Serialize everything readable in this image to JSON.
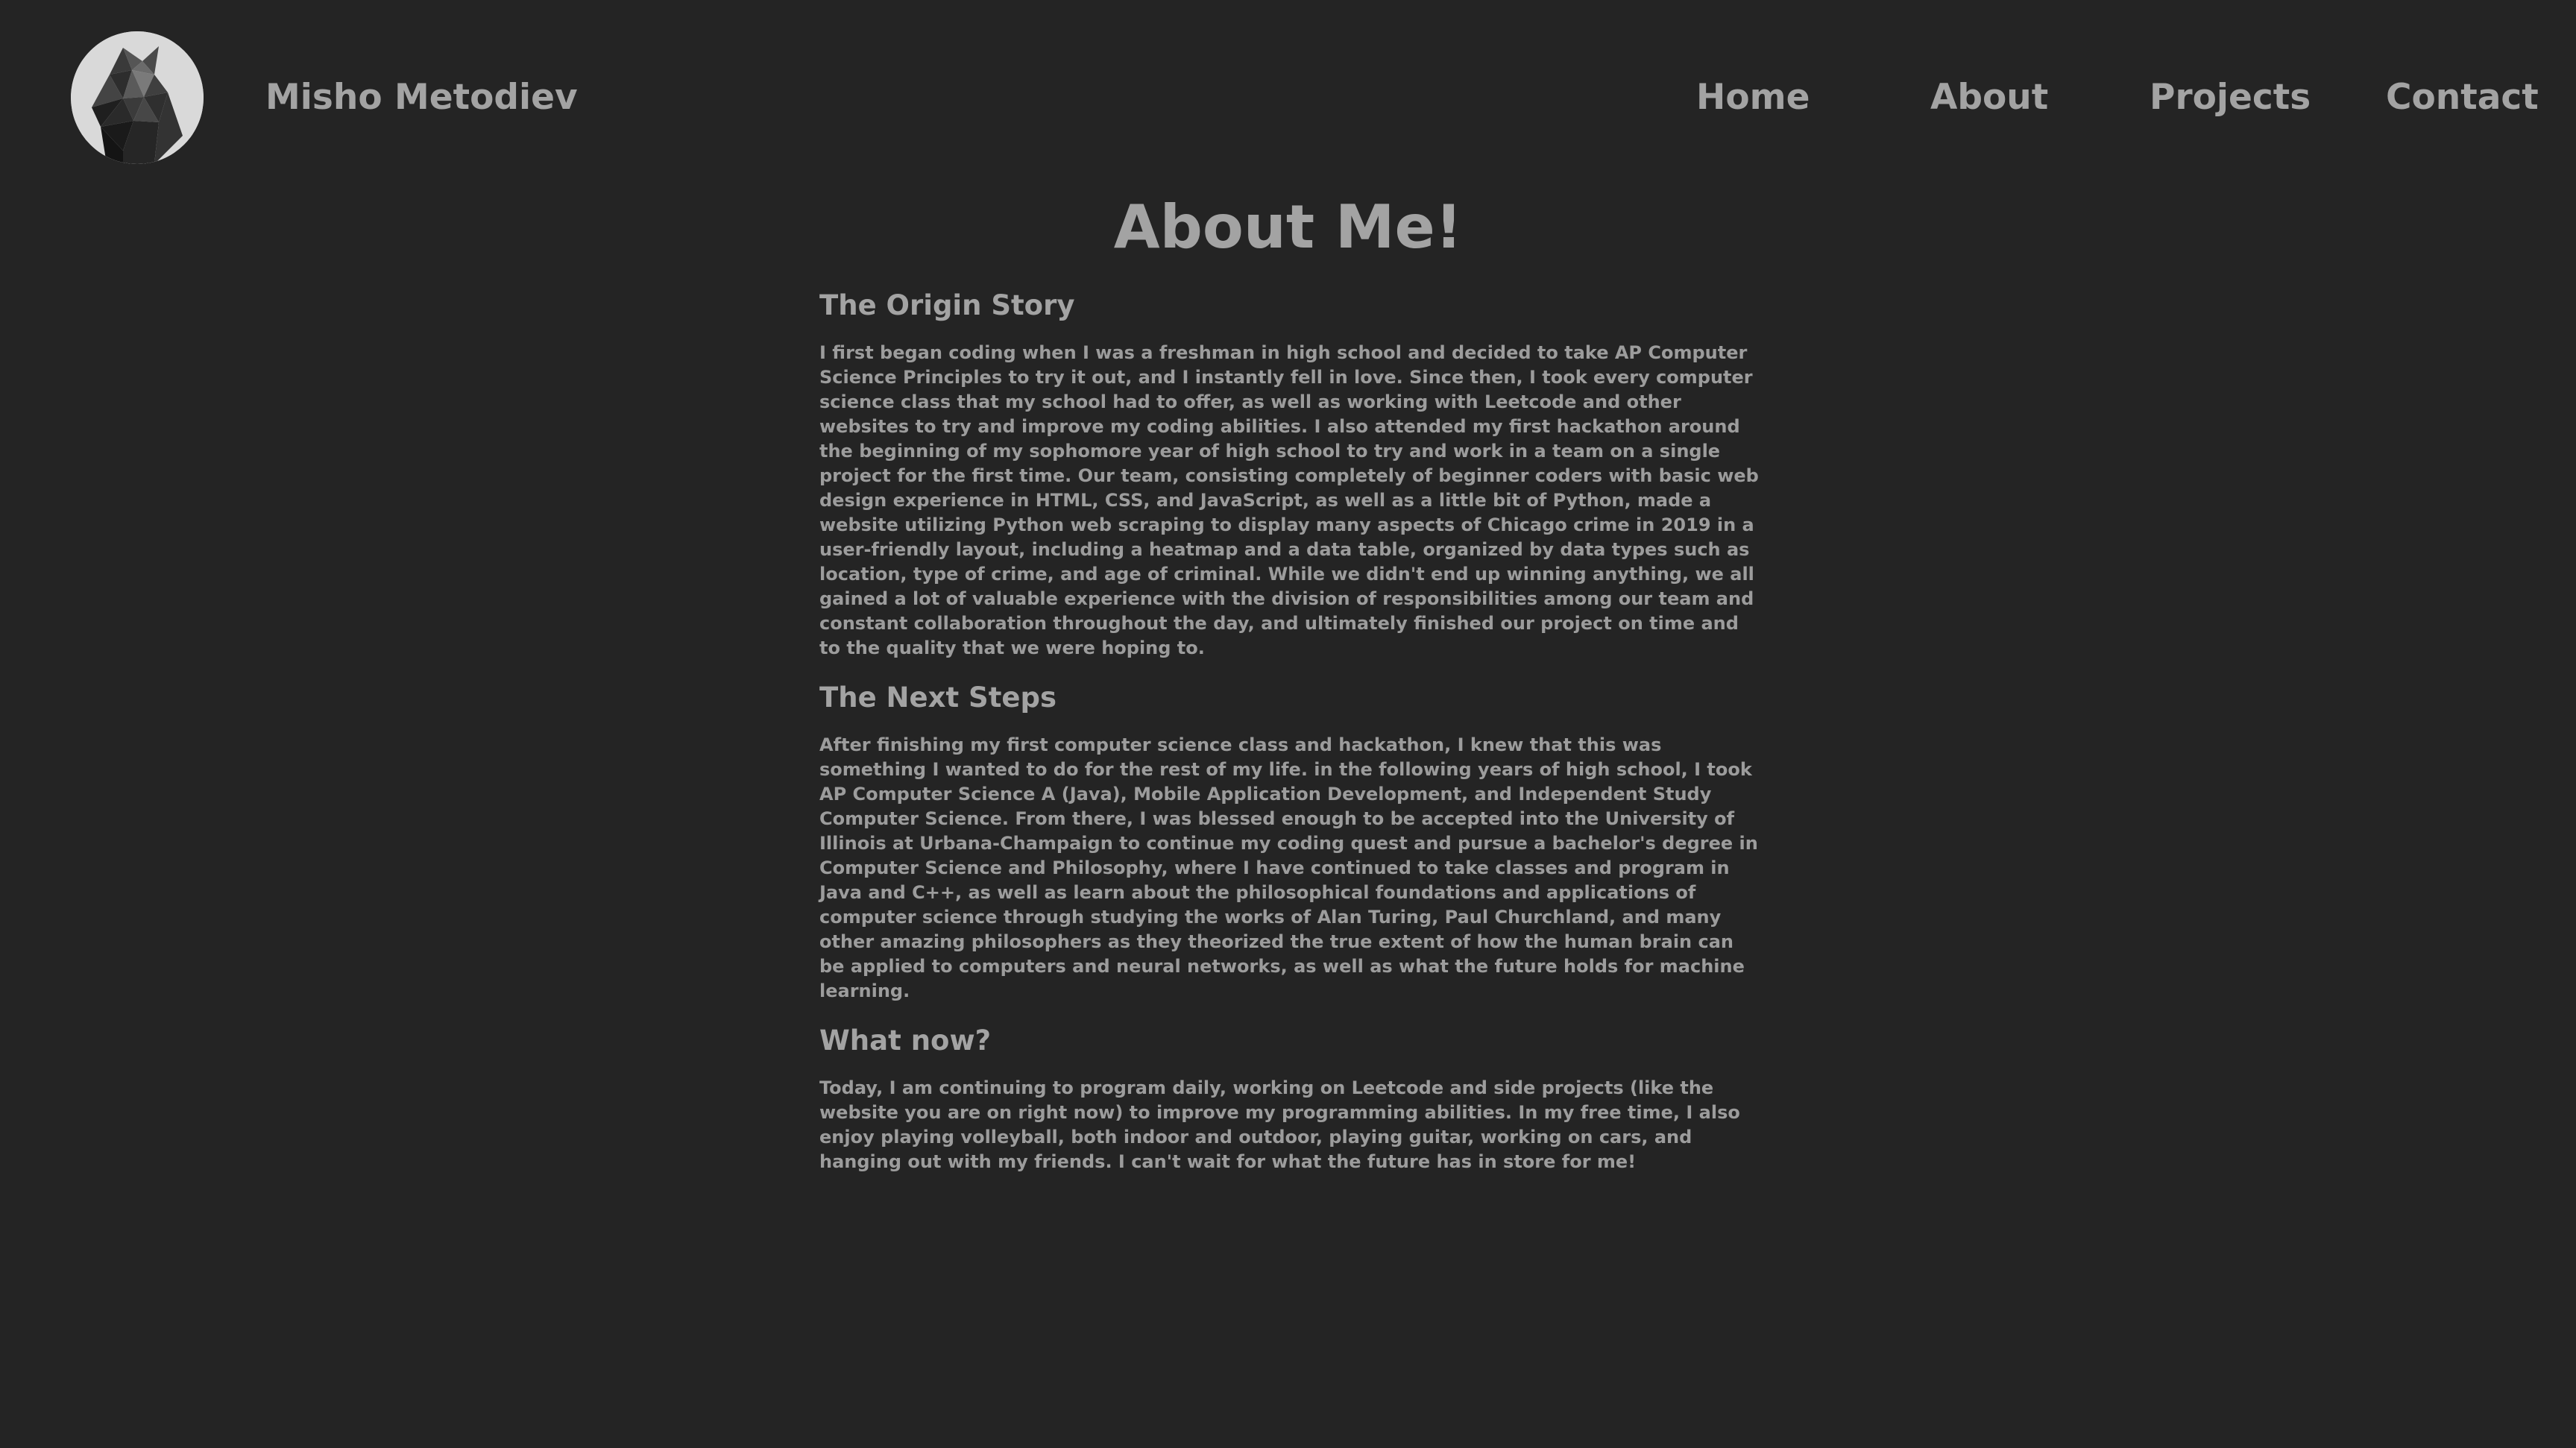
{
  "header": {
    "site_name": "Misho Metodiev",
    "avatar_alt": "Low-poly wolf head logo"
  },
  "nav": {
    "items": [
      {
        "label": "Home"
      },
      {
        "label": "About"
      },
      {
        "label": "Projects"
      },
      {
        "label": "Contact"
      }
    ]
  },
  "main": {
    "title": "About Me!",
    "sections": [
      {
        "heading": "The Origin Story",
        "body": "I first began coding when I was a freshman in high school and decided to take AP Computer Science Principles to try it out, and I instantly fell in love. Since then, I took every computer science class that my school had to offer, as well as working with Leetcode and other websites to try and improve my coding abilities. I also attended my first hackathon around the beginning of my sophomore year of high school to try and work in a team on a single project for the first time. Our team, consisting completely of beginner coders with basic web design experience in HTML, CSS, and JavaScript, as well as a little bit of Python, made a website utilizing Python web scraping to display many aspects of Chicago crime in 2019 in a user-friendly layout, including a heatmap and a data table, organized by data types such as location, type of crime, and age of criminal. While we didn't end up winning anything, we all gained a lot of valuable experience with the division of responsibilities among our team and constant collaboration throughout the day, and ultimately finished our project on time and to the quality that we were hoping to."
      },
      {
        "heading": "The Next Steps",
        "body": "After finishing my first computer science class and hackathon, I knew that this was something I wanted to do for the rest of my life. in the following years of high school, I took AP Computer Science A (Java), Mobile Application Development, and Independent Study Computer Science. From there, I was blessed enough to be accepted into the University of Illinois at Urbana-Champaign to continue my coding quest and pursue a bachelor's degree in Computer Science and Philosophy, where I have continued to take classes and program in Java and C++, as well as learn about the philosophical foundations and applications of computer science through studying the works of Alan Turing, Paul Churchland, and many other amazing philosophers as they theorized the true extent of how the human brain can be applied to computers and neural networks, as well as what the future holds for machine learning."
      },
      {
        "heading": "What now?",
        "body": "Today, I am continuing to program daily, working on Leetcode and side projects (like the website you are on right now) to improve my programming abilities. In my free time, I also enjoy playing volleyball, both indoor and outdoor, playing guitar, working on cars, and hanging out with my friends. I can't wait for what the future has in store for me!"
      }
    ]
  },
  "colors": {
    "background": "#242424",
    "text": "#a3a3a3",
    "avatar_bg": "#d8d8d8"
  }
}
